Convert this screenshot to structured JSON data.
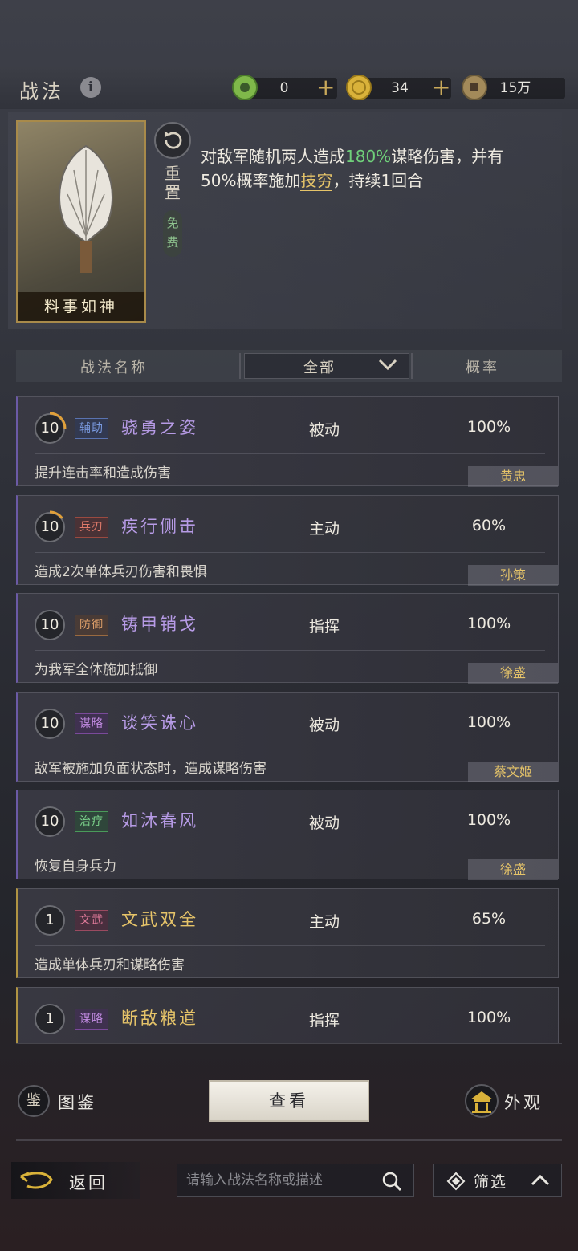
{
  "header": {
    "title": "战法",
    "currencies": [
      {
        "icon": "jade-coin-icon",
        "value": "0",
        "color": "#7fb84a"
      },
      {
        "icon": "gold-coin-icon",
        "value": "34",
        "color": "#d9b23a"
      },
      {
        "icon": "copper-coin-icon",
        "value": "15万",
        "color": "#a38a5a"
      }
    ]
  },
  "detail": {
    "card_name": "料事如神",
    "reset_label": "重置",
    "free_label": "免费",
    "desc_1": "对敌军随机两人造成",
    "desc_pct": "180%",
    "desc_2": "谋略伤害，并有50%概率施加",
    "desc_status": "技穷",
    "desc_3": "，持续1回合"
  },
  "table_header": {
    "name_col": "战法名称",
    "filter_value": "全部",
    "prob_col": "概率"
  },
  "skills": [
    {
      "level": "10",
      "tag": "辅助",
      "tag_class": "support",
      "name": "骁勇之姿",
      "name_class": "purple",
      "type": "被动",
      "prob": "100%",
      "desc": "提升连击率和造成伤害",
      "hero": "黄忠",
      "progress": 0.25
    },
    {
      "level": "10",
      "tag": "兵刃",
      "tag_class": "blade",
      "name": "疾行侧击",
      "name_class": "purple",
      "type": "主动",
      "prob": "60%",
      "desc": "造成2次单体兵刃伤害和畏惧",
      "hero": "孙策",
      "progress": 0.15
    },
    {
      "level": "10",
      "tag": "防御",
      "tag_class": "defense",
      "name": "铸甲销戈",
      "name_class": "purple",
      "type": "指挥",
      "prob": "100%",
      "desc": "为我军全体施加抵御",
      "hero": "徐盛",
      "progress": 0
    },
    {
      "level": "10",
      "tag": "谋略",
      "tag_class": "strategy",
      "name": "谈笑诛心",
      "name_class": "purple",
      "type": "被动",
      "prob": "100%",
      "desc": "敌军被施加负面状态时，造成谋略伤害",
      "hero": "蔡文姬",
      "progress": 0
    },
    {
      "level": "10",
      "tag": "治疗",
      "tag_class": "heal",
      "name": "如沐春风",
      "name_class": "purple",
      "type": "被动",
      "prob": "100%",
      "desc": "恢复自身兵力",
      "hero": "徐盛",
      "progress": 0
    },
    {
      "level": "1",
      "tag": "文武",
      "tag_class": "wenwu",
      "name": "文武双全",
      "name_class": "gold",
      "type": "主动",
      "prob": "65%",
      "desc": "造成单体兵刃和谋略伤害",
      "hero": "",
      "progress": 0
    },
    {
      "level": "1",
      "tag": "谋略",
      "tag_class": "strategy",
      "name": "断敌粮道",
      "name_class": "gold",
      "type": "指挥",
      "prob": "100%",
      "desc": "",
      "hero": "",
      "progress": 0
    }
  ],
  "footer": {
    "atlas_label": "图鉴",
    "atlas_glyph": "鉴",
    "view_label": "查看",
    "look_label": "外观",
    "back_label": "返回",
    "search_placeholder": "请输入战法名称或描述",
    "filter_label": "筛选"
  }
}
